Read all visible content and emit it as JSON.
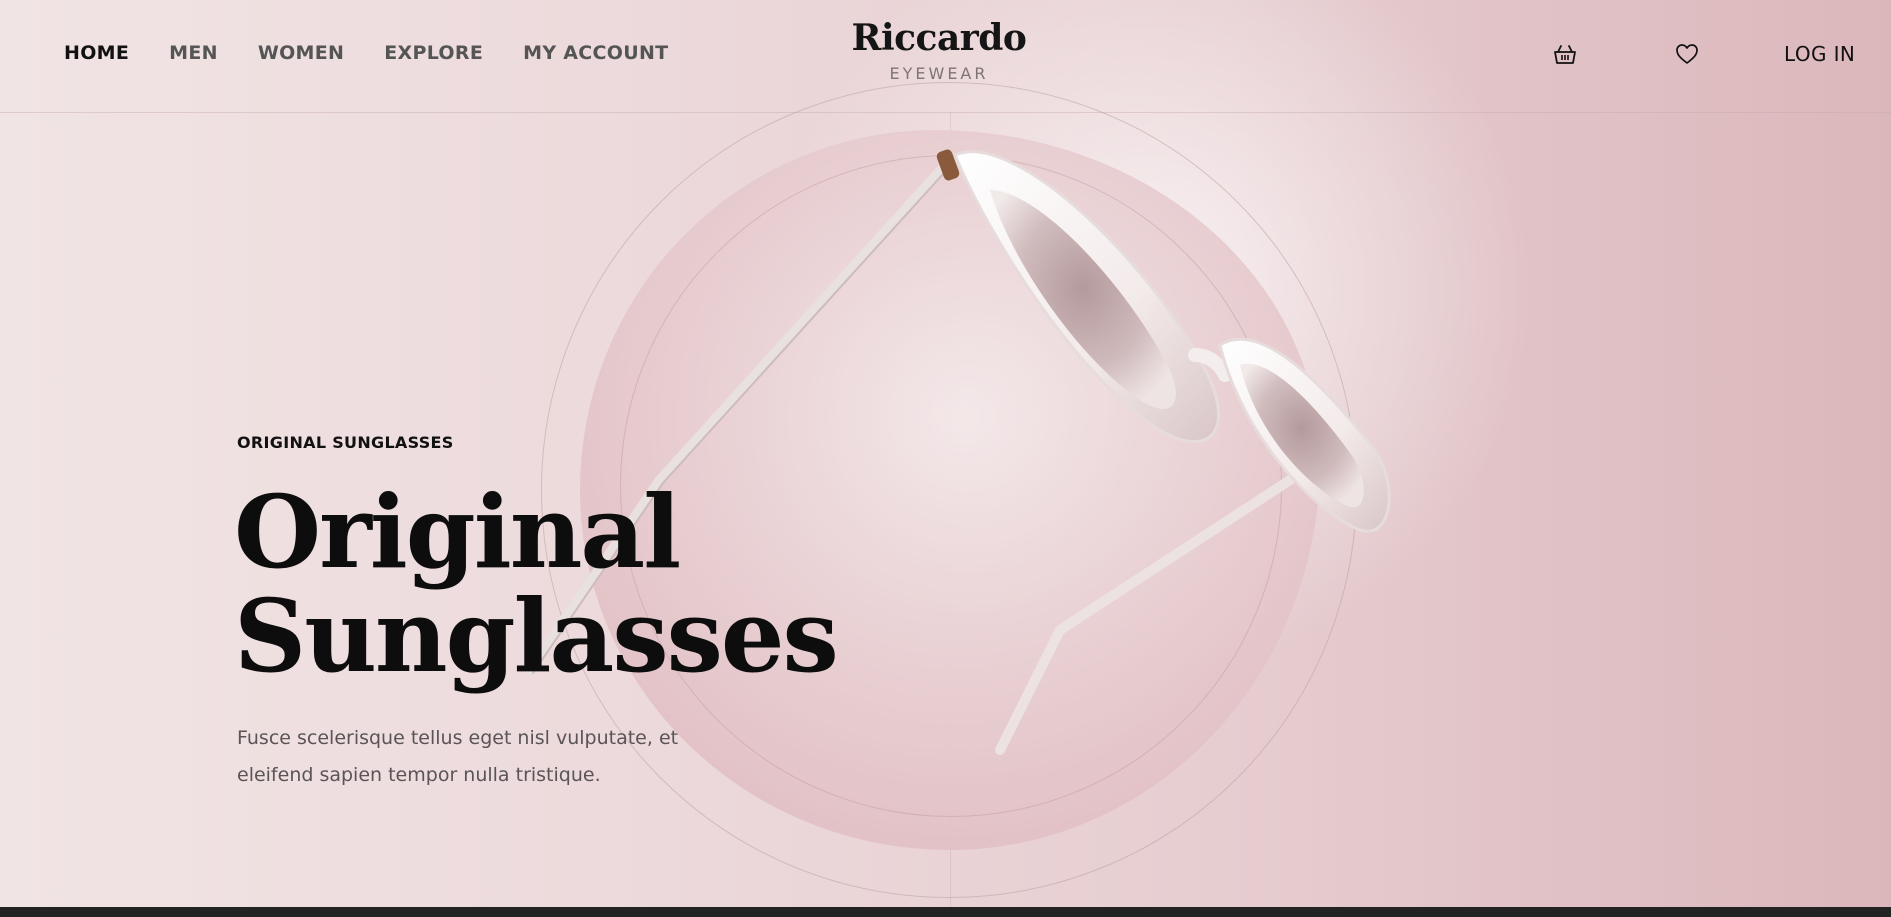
{
  "header": {
    "nav": [
      {
        "label": "HOME",
        "active": true
      },
      {
        "label": "MEN"
      },
      {
        "label": "WOMEN"
      },
      {
        "label": "EXPLORE"
      },
      {
        "label": "MY ACCOUNT"
      }
    ],
    "logo": {
      "name": "Riccardo",
      "tagline": "EYEWEAR"
    },
    "icons": {
      "cart": "basket-icon",
      "wishlist": "heart-icon"
    },
    "login_label": "LOG IN"
  },
  "hero": {
    "eyebrow": "ORIGINAL SUNGLASSES",
    "title_line1": "Original",
    "title_line2": "Sunglasses",
    "desc_line1": "Fusce scelerisque tellus eget nisl vulputate, et",
    "desc_line2": "eleifend sapien tempor nulla tristique.",
    "image": "white-cat-eye-sunglasses"
  },
  "colors": {
    "background": "#ecd9db",
    "text": "#111111",
    "muted": "#5a5456",
    "footer": "#232323"
  }
}
